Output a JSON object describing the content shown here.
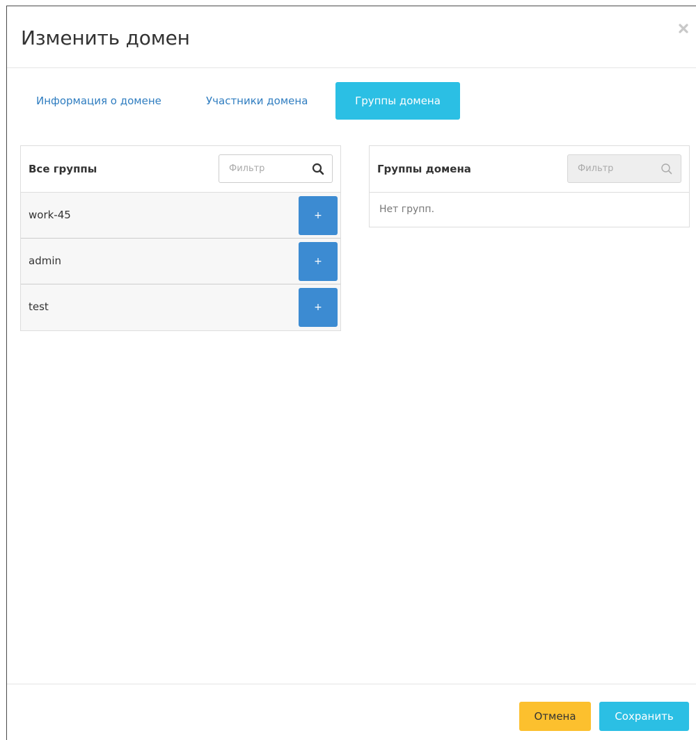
{
  "modal": {
    "title": "Изменить домен",
    "close_icon": "close-icon"
  },
  "tabs": [
    {
      "label": "Информация о домене",
      "active": false
    },
    {
      "label": "Участники домена",
      "active": false
    },
    {
      "label": "Группы домена",
      "active": true
    }
  ],
  "all_groups": {
    "title": "Все группы",
    "filter_placeholder": "Фильтр",
    "filter_icon": "search-icon",
    "items": [
      {
        "name": "work-45",
        "action": "+"
      },
      {
        "name": "admin",
        "action": "+"
      },
      {
        "name": "test",
        "action": "+"
      }
    ]
  },
  "domain_groups": {
    "title": "Группы домена",
    "filter_placeholder": "Фильтр",
    "filter_icon": "search-icon",
    "empty_text": "Нет групп."
  },
  "footer": {
    "cancel_label": "Отмена",
    "save_label": "Сохранить"
  },
  "colors": {
    "active_tab": "#2bbfe4",
    "add_button": "#3c8bd2",
    "cancel_button": "#fcc02e",
    "save_button": "#2bbfe4",
    "link": "#2f7dc0"
  }
}
